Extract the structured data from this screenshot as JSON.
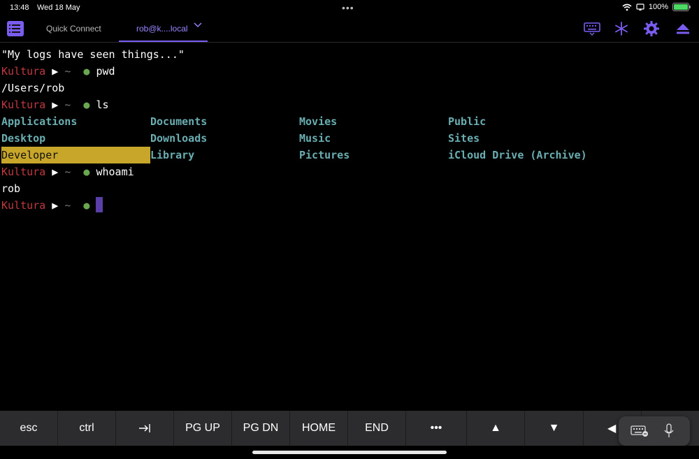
{
  "status_bar": {
    "time": "13:48",
    "date": "Wed 18 May",
    "battery_percent": "100%",
    "battery_level": 1.0
  },
  "toolbar": {
    "tabs": [
      {
        "label": "Quick Connect"
      },
      {
        "label": "rob@k....local"
      }
    ],
    "icons": [
      "menu-icon",
      "keyboard-icon",
      "asterisk-icon",
      "gear-icon",
      "eject-icon"
    ],
    "accent_color": "#7b5cf0"
  },
  "terminal": {
    "motd": "\"My logs have seen things...\"",
    "prompt": {
      "host": "Kultura",
      "arrow": "▶",
      "path": "~",
      "dot": "●"
    },
    "commands": [
      "pwd",
      "ls",
      "whoami"
    ],
    "pwd_output": "/Users/rob",
    "ls_output": [
      [
        "Applications",
        "Documents",
        "Movies",
        "Public"
      ],
      [
        "Desktop",
        "Downloads",
        "Music",
        "Sites"
      ],
      [
        "Developer",
        "Library",
        "Pictures",
        "iCloud Drive (Archive)"
      ]
    ],
    "whoami_output": "rob"
  },
  "keybar": {
    "keys": [
      "esc",
      "ctrl",
      "⇥",
      "PG UP",
      "PG DN",
      "HOME",
      "END",
      "•••",
      "▲",
      "▼",
      "◀"
    ]
  }
}
